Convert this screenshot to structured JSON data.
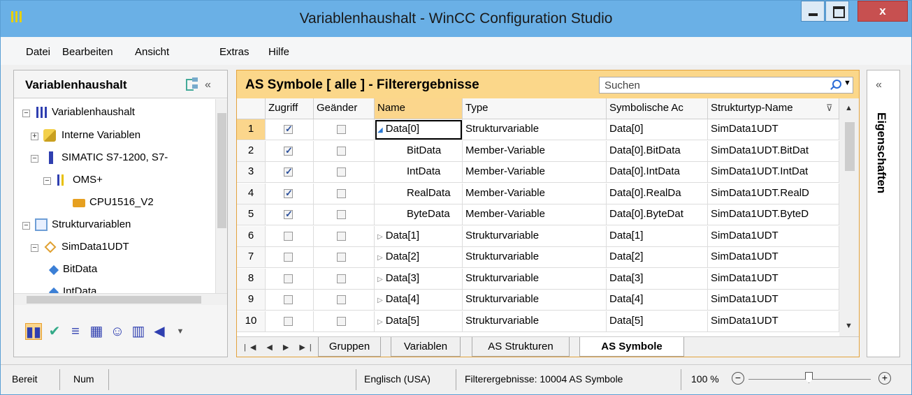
{
  "window": {
    "title": "Variablenhaushalt - WinCC Configuration Studio",
    "close_glyph": "x"
  },
  "menu": [
    "Datei",
    "Bearbeiten",
    "Ansicht",
    "Extras",
    "Hilfe"
  ],
  "left_panel": {
    "title": "Variablenhaushalt",
    "collapse": "«",
    "tree": [
      {
        "label": "Variablenhaushalt",
        "toggle": "−"
      },
      {
        "label": "Interne Variablen",
        "toggle": "+"
      },
      {
        "label": "SIMATIC S7-1200, S7-",
        "toggle": "−"
      },
      {
        "label": "OMS+",
        "toggle": "−"
      },
      {
        "label": "CPU1516_V2",
        "toggle": ""
      },
      {
        "label": "Strukturvariablen",
        "toggle": "−"
      },
      {
        "label": "SimData1UDT",
        "toggle": "−"
      },
      {
        "label": "BitData",
        "toggle": ""
      },
      {
        "label": "IntData",
        "toggle": ""
      }
    ],
    "bottom_icons": [
      "wincc-icon",
      "checklist-icon",
      "tags-icon",
      "archive-icon",
      "users-icon",
      "tagtable-icon",
      "sound-icon",
      "dropdown-icon"
    ]
  },
  "center": {
    "title": "AS Symbole [ alle ] - Filterergebnisse",
    "search_placeholder": "Suchen",
    "columns": [
      "",
      "Zugriff",
      "Geänder",
      "Name",
      "Type",
      "Symbolische Ac",
      "Strukturtyp-Name"
    ],
    "rows": [
      {
        "n": "1",
        "zugriff": true,
        "geaendert": false,
        "name": "Data[0]",
        "expand": "open",
        "type": "Strukturvariable",
        "symaddr": "Data[0]",
        "struct": "SimData1UDT",
        "indent": false
      },
      {
        "n": "2",
        "zugriff": true,
        "geaendert": false,
        "name": "BitData",
        "expand": "",
        "type": "Member-Variable",
        "symaddr": "Data[0].BitData",
        "struct": "SimData1UDT.BitDat",
        "indent": true
      },
      {
        "n": "3",
        "zugriff": true,
        "geaendert": false,
        "name": "IntData",
        "expand": "",
        "type": "Member-Variable",
        "symaddr": "Data[0].IntData",
        "struct": "SimData1UDT.IntDat",
        "indent": true
      },
      {
        "n": "4",
        "zugriff": true,
        "geaendert": false,
        "name": "RealData",
        "expand": "",
        "type": "Member-Variable",
        "symaddr": "Data[0].RealDa",
        "struct": "SimData1UDT.RealD",
        "indent": true
      },
      {
        "n": "5",
        "zugriff": true,
        "geaendert": false,
        "name": "ByteData",
        "expand": "",
        "type": "Member-Variable",
        "symaddr": "Data[0].ByteDat",
        "struct": "SimData1UDT.ByteD",
        "indent": true
      },
      {
        "n": "6",
        "zugriff": false,
        "geaendert": false,
        "name": "Data[1]",
        "expand": "closed",
        "type": "Strukturvariable",
        "symaddr": "Data[1]",
        "struct": "SimData1UDT",
        "indent": false
      },
      {
        "n": "7",
        "zugriff": false,
        "geaendert": false,
        "name": "Data[2]",
        "expand": "closed",
        "type": "Strukturvariable",
        "symaddr": "Data[2]",
        "struct": "SimData1UDT",
        "indent": false
      },
      {
        "n": "8",
        "zugriff": false,
        "geaendert": false,
        "name": "Data[3]",
        "expand": "closed",
        "type": "Strukturvariable",
        "symaddr": "Data[3]",
        "struct": "SimData1UDT",
        "indent": false
      },
      {
        "n": "9",
        "zugriff": false,
        "geaendert": false,
        "name": "Data[4]",
        "expand": "closed",
        "type": "Strukturvariable",
        "symaddr": "Data[4]",
        "struct": "SimData1UDT",
        "indent": false
      },
      {
        "n": "10",
        "zugriff": false,
        "geaendert": false,
        "name": "Data[5]",
        "expand": "closed",
        "type": "Strukturvariable",
        "symaddr": "Data[5]",
        "struct": "SimData1UDT",
        "indent": false
      }
    ],
    "tabs": [
      "Gruppen",
      "Variablen",
      "AS Strukturen",
      "AS Symbole"
    ],
    "active_tab": "AS Symbole"
  },
  "right_panel": {
    "label": "Eigenschaften",
    "collapse": "«"
  },
  "status": {
    "ready": "Bereit",
    "num": "Num",
    "language": "Englisch (USA)",
    "filter": "Filterergebnisse: 10004 AS Symbole",
    "zoom": "100 %",
    "zoom_level": 0.5
  },
  "colors": {
    "title_bar": "#6ab0e6",
    "accent": "#fbd78a",
    "selection": "#fbd68c"
  }
}
